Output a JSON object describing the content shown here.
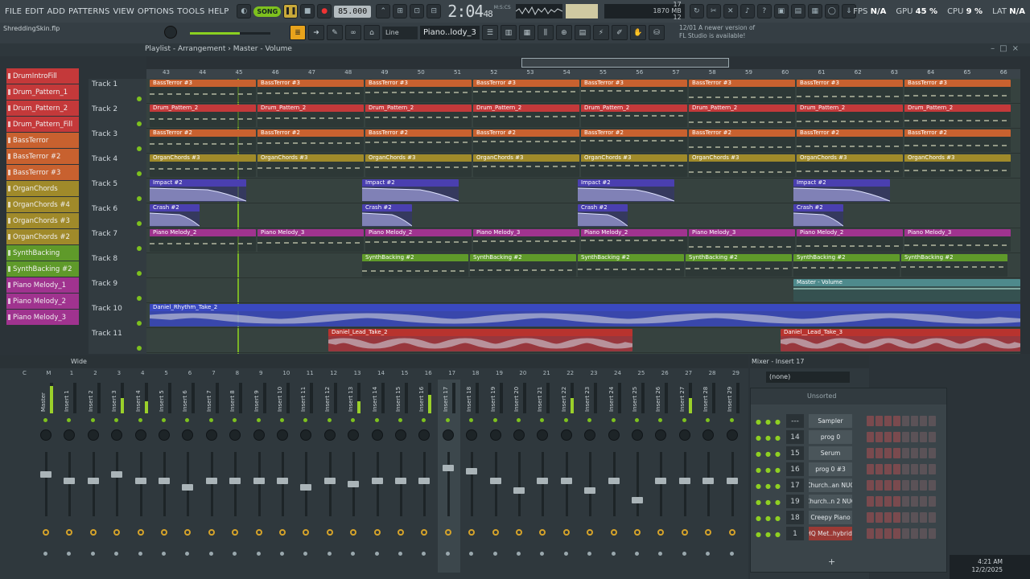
{
  "menu": [
    "FILE",
    "EDIT",
    "ADD",
    "PATTERNS",
    "VIEW",
    "OPTIONS",
    "TOOLS",
    "HELP"
  ],
  "transport": {
    "song_label": "SONG",
    "tempo": "85.000",
    "time_main": "2:04",
    "time_sub": "48",
    "time_unit": "M:S:CS"
  },
  "memory": {
    "cpu_voices": "17",
    "ram": "1870 MB",
    "poly": "12"
  },
  "stats": {
    "fps_label": "FPS",
    "fps": "N/A",
    "gpu_label": "GPU",
    "gpu": "45 %",
    "cpu_label": "CPU",
    "cpu": "9 %",
    "lat_label": "LAT",
    "lat": "N/A"
  },
  "project": {
    "filename": "ShreddingSkin.flp"
  },
  "toolbar2": {
    "snap": "Line",
    "pattern": "Piano..lody_3"
  },
  "news": {
    "date": "12/01",
    "line1": "A newer version of",
    "line2": "FL Studio is available!"
  },
  "playlist": {
    "title": "Playlist - Arrangement",
    "separator": "›",
    "automation": "Master - Volume",
    "bars": [
      "43",
      "44",
      "45",
      "46",
      "47",
      "48",
      "49",
      "50",
      "51",
      "52",
      "53",
      "54",
      "55",
      "56",
      "57",
      "58",
      "59",
      "60",
      "61",
      "62",
      "63",
      "64",
      "65",
      "66"
    ]
  },
  "picker": [
    {
      "name": "DrumIntroFill",
      "color": "#c4393a"
    },
    {
      "name": "Drum_Pattern_1",
      "color": "#c4393a"
    },
    {
      "name": "Drum_Pattern_2",
      "color": "#c4393a"
    },
    {
      "name": "Drum_Pattern_Fill",
      "color": "#c4393a"
    },
    {
      "name": "BassTerror",
      "color": "#c8612f"
    },
    {
      "name": "BassTerror #2",
      "color": "#c8612f"
    },
    {
      "name": "BassTerror #3",
      "color": "#c8612f"
    },
    {
      "name": "OrganChords",
      "color": "#a08a2a"
    },
    {
      "name": "OrganChords #4",
      "color": "#a08a2a"
    },
    {
      "name": "OrganChords #3",
      "color": "#a08a2a"
    },
    {
      "name": "OrganChords #2",
      "color": "#a08a2a"
    },
    {
      "name": "SynthBacking",
      "color": "#5f9a2a"
    },
    {
      "name": "SynthBacking #2",
      "color": "#5f9a2a"
    },
    {
      "name": "Piano Melody_1",
      "color": "#a0338f"
    },
    {
      "name": "Piano Melody_2",
      "color": "#a0338f"
    },
    {
      "name": "Piano Melody_3",
      "color": "#a0338f"
    }
  ],
  "tracks": [
    "Track 1",
    "Track 2",
    "Track 3",
    "Track 4",
    "Track 5",
    "Track 6",
    "Track 7",
    "Track 8",
    "Track 9",
    "Track 10",
    "Track 11"
  ],
  "clips": {
    "t1": {
      "label": "BassTerror #3",
      "color": "#c8612f"
    },
    "t2": {
      "label": "Drum_Pattern_2",
      "color": "#c4393a"
    },
    "t3": {
      "label": "BassTerror #2",
      "color": "#c8612f"
    },
    "t4": {
      "label": "OrganChords #3",
      "color": "#a08a2a"
    },
    "t5": {
      "label": "Impact #2",
      "color": "#4a3fb0"
    },
    "t6": {
      "label": "Crash #2",
      "color": "#4a3fb0"
    },
    "t7a": {
      "label": "Piano Melody_2",
      "color": "#a0338f"
    },
    "t7b": {
      "label": "Piano Melody_3",
      "color": "#a0338f"
    },
    "t8": {
      "label": "SynthBacking #2",
      "color": "#5f9a2a"
    },
    "t9": {
      "label": "Master - Volume",
      "color": "#4e8a8c"
    },
    "t10": {
      "label": "Daniel_Rhythm_Take_2",
      "color": "#3a49c0"
    },
    "t11a": {
      "label": "Daniel_Lead_Take_2",
      "color": "#b8332e"
    },
    "t11b": {
      "label": "Daniel__Lead_Take_3",
      "color": "#b8332e"
    }
  },
  "mixer": {
    "title": "Wide",
    "strips": [
      "Master",
      "Insert 1",
      "Insert 2",
      "Insert 3",
      "Insert 4",
      "Insert 5",
      "Insert 6",
      "Insert 7",
      "Insert 8",
      "Insert 9",
      "Insert 10",
      "Insert 11",
      "Insert 12",
      "Insert 13",
      "Insert 14",
      "Insert 15",
      "Insert 16",
      "Insert 17",
      "Insert 18",
      "Insert 19",
      "Insert 20",
      "Insert 21",
      "Insert 22",
      "Insert 23",
      "Insert 24",
      "Insert 25",
      "Insert 26",
      "Insert 27",
      "Insert 28",
      "Insert 29"
    ],
    "numbers": [
      "C",
      "M",
      "1",
      "2",
      "3",
      "4",
      "5",
      "6",
      "7",
      "8",
      "9",
      "10",
      "11",
      "12",
      "13",
      "14",
      "15",
      "16",
      "17",
      "18",
      "19",
      "20",
      "21",
      "22",
      "23",
      "24",
      "25",
      "26",
      "27",
      "28",
      "29"
    ],
    "levels": [
      0.9,
      0.0,
      0.0,
      0.5,
      0.4,
      0.0,
      0.0,
      0.0,
      0.0,
      0.0,
      0.0,
      0.0,
      0.0,
      0.4,
      0.0,
      0.0,
      0.6,
      0.0,
      0.0,
      0.0,
      0.0,
      0.0,
      0.5,
      0.0,
      0.0,
      0.0,
      0.0,
      0.5,
      0.0,
      0.0
    ],
    "faders": [
      0.7,
      0.6,
      0.6,
      0.7,
      0.6,
      0.6,
      0.5,
      0.6,
      0.6,
      0.6,
      0.6,
      0.5,
      0.6,
      0.55,
      0.6,
      0.6,
      0.6,
      0.8,
      0.75,
      0.6,
      0.45,
      0.6,
      0.6,
      0.45,
      0.6,
      0.3,
      0.6,
      0.6,
      0.6,
      0.6
    ]
  },
  "insert_panel": {
    "title": "Mixer - Insert 17",
    "route": "(none)"
  },
  "rack": {
    "filter": "Unsorted",
    "channels": [
      {
        "num": "---",
        "name": "Sampler"
      },
      {
        "num": "14",
        "name": "prog 0"
      },
      {
        "num": "15",
        "name": "Serum"
      },
      {
        "num": "16",
        "name": "prog 0 #3"
      },
      {
        "num": "17",
        "name": "Church..an NUC"
      },
      {
        "num": "19",
        "name": "Church..n 2 NUC"
      },
      {
        "num": "18",
        "name": "Creepy Piano"
      },
      {
        "num": "1",
        "name": "HQ Met..hybrid)"
      }
    ],
    "add": "+"
  },
  "clock": {
    "time": "4:21 AM",
    "date": "12/2/2025"
  }
}
